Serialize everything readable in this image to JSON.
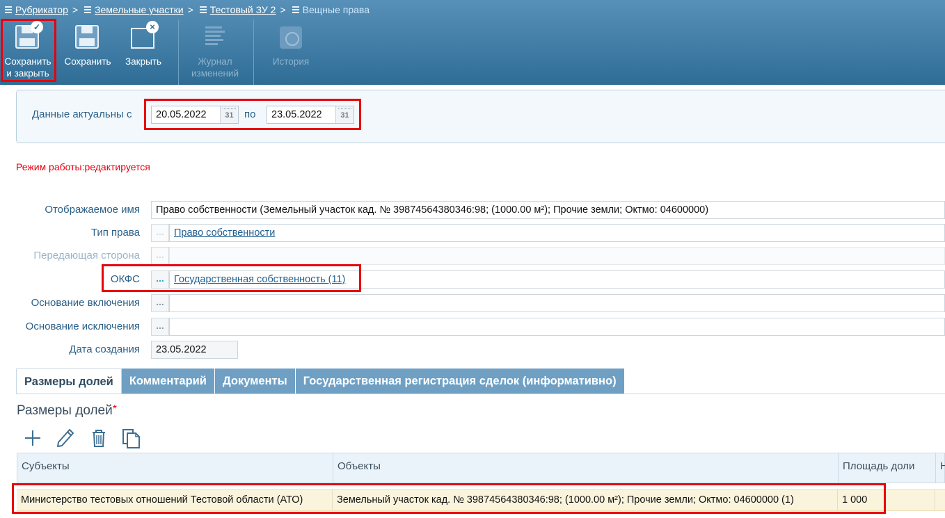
{
  "breadcrumb": {
    "items": [
      {
        "label": "Рубрикатор"
      },
      {
        "label": "Земельные участки"
      },
      {
        "label": "Тестовый ЗУ 2"
      }
    ],
    "current": "Вещные права",
    "separator": ">"
  },
  "toolbar": {
    "save_close_line1": "Сохранить",
    "save_close_line2": "и закрыть",
    "save": "Сохранить",
    "close": "Закрыть",
    "journal_line1": "Журнал",
    "journal_line2": "изменений",
    "history": "История"
  },
  "period": {
    "label": "Данные актуальны с",
    "from": "20.05.2022",
    "to_label": "по",
    "to": "23.05.2022",
    "calendar_icon_text": "31"
  },
  "mode_text": "Режим работы:редактируется",
  "form": {
    "display_name": {
      "label": "Отображаемое имя",
      "value": "Право собственности (Земельный участок  кад. № 39874564380346:98; (1000.00 м²); Прочие земли; Октмо: 04600000)"
    },
    "right_type": {
      "label": "Тип права",
      "value": "Право собственности"
    },
    "transferring_party": {
      "label": "Передающая сторона",
      "value": ""
    },
    "okfs": {
      "label": "ОКФС",
      "value": "Государственная собственность (11)"
    },
    "inclusion_basis": {
      "label": "Основание включения",
      "value": ""
    },
    "exclusion_basis": {
      "label": "Основание исключения",
      "value": ""
    },
    "created_date": {
      "label": "Дата создания",
      "value": "23.05.2022"
    }
  },
  "dots_label": "...",
  "tabs": [
    {
      "label": "Размеры долей"
    },
    {
      "label": "Комментарий"
    },
    {
      "label": "Документы"
    },
    {
      "label": "Государственная регистрация сделок (информативно)"
    }
  ],
  "section": {
    "title": "Размеры долей",
    "required_mark": "*"
  },
  "table": {
    "columns": [
      "Субъекты",
      "Объекты",
      "Площадь доли",
      "Н"
    ],
    "rows": [
      [
        "Министерство тестовых отношений Тестовой области (АТО)",
        "Земельный участок кад. № 39874564380346:98; (1000.00 м²); Прочие земли; Октмо: 04600000 (1)",
        "1 000",
        ""
      ]
    ]
  },
  "colors": {
    "toolbar_top": "#5790b8",
    "toolbar_bottom": "#2f6d96",
    "highlight_box": "#e8000b",
    "mode_text": "#e5000d",
    "tab_inactive": "#6fa0c4",
    "selected_row": "#fbf4dc"
  }
}
